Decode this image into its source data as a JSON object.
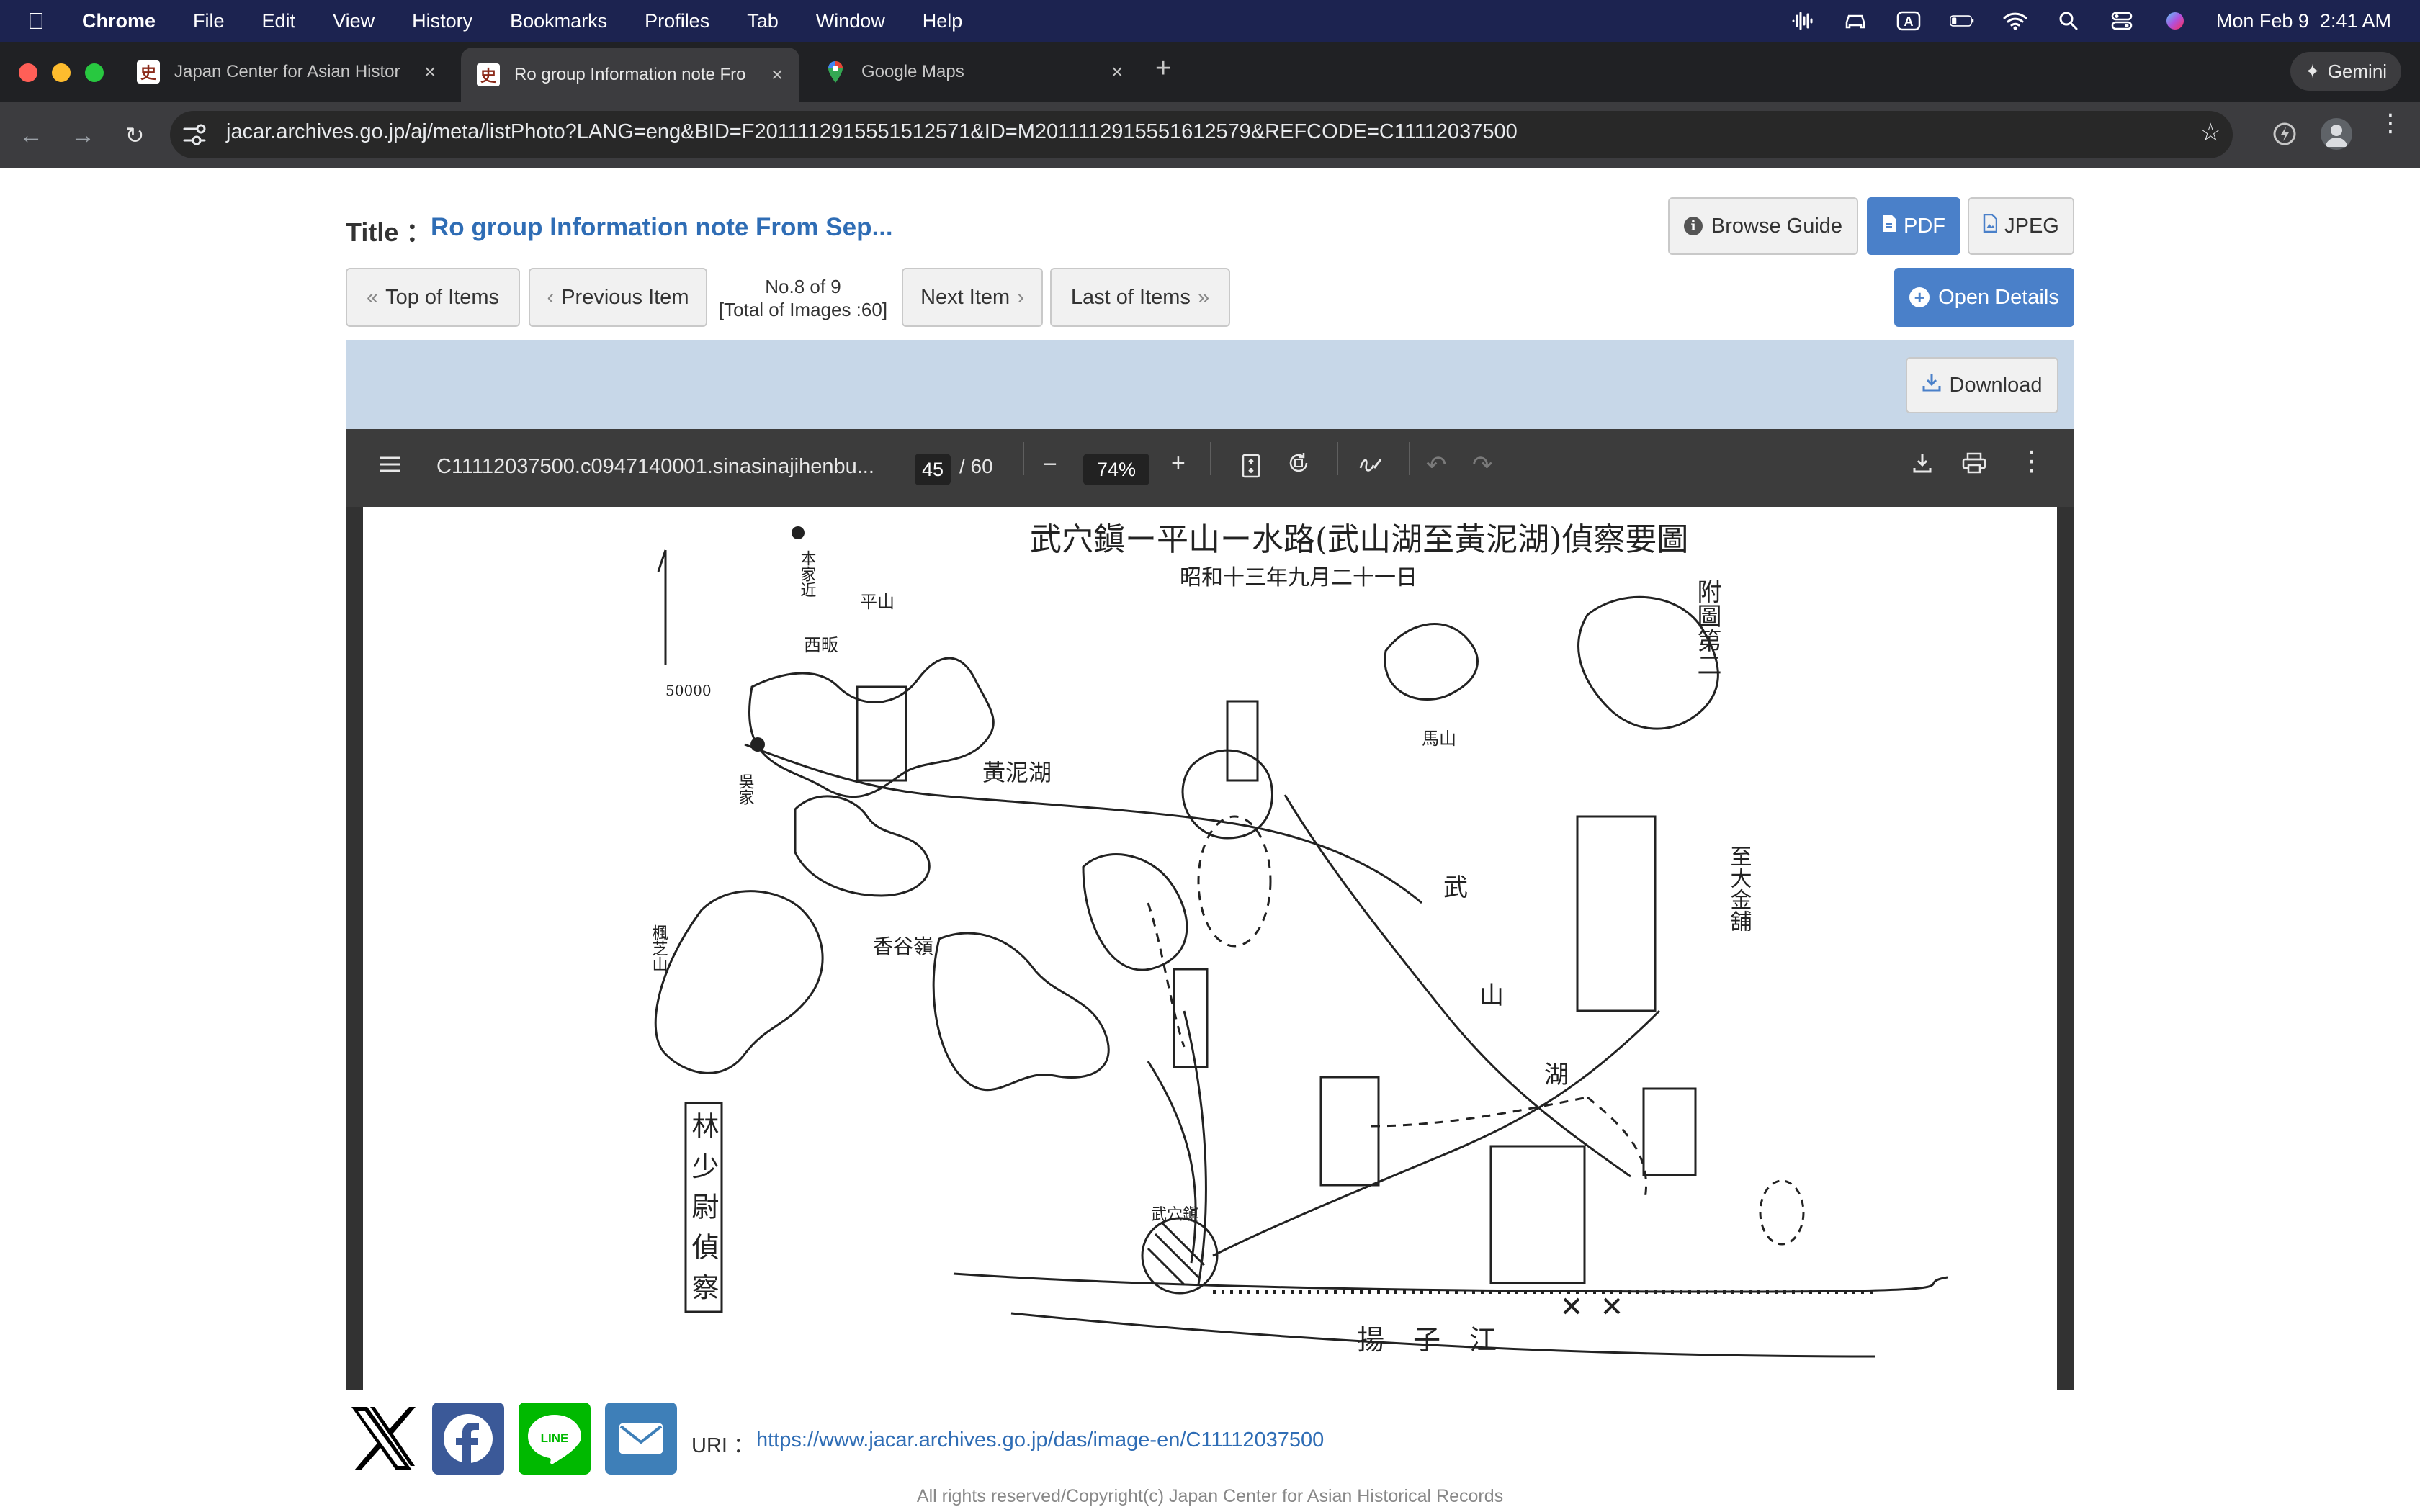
{
  "menubar": {
    "app": "Chrome",
    "items": [
      "File",
      "Edit",
      "View",
      "History",
      "Bookmarks",
      "Profiles",
      "Tab",
      "Window",
      "Help"
    ],
    "clock": "Mon Feb 9  2:41 AM"
  },
  "tabs": [
    {
      "title": "Japan Center for Asian Histor",
      "favicon": "史"
    },
    {
      "title": "Ro group Information note Fro",
      "favicon": "史"
    },
    {
      "title": "Google Maps",
      "favicon": "map-pin"
    }
  ],
  "gemini": "Gemini",
  "url": "jacar.archives.go.jp/aj/meta/listPhoto?LANG=eng&BID=F2011112915551512571&ID=M2011112915551612579&REFCODE=C11112037500",
  "page": {
    "title_label": "Title ：",
    "title_value": "Ro group Information note From Sep...",
    "browse_guide": "Browse Guide",
    "pdf": "PDF",
    "jpeg": "JPEG",
    "top_items": "Top of Items",
    "prev_item": "Previous Item",
    "counter_line1": "No.8 of 9",
    "counter_line2": "[Total of Images :60]",
    "next_item": "Next Item",
    "last_items": "Last of Items",
    "open_details": "Open Details",
    "download": "Download"
  },
  "pdf": {
    "filename": "C11112037500.c0947140001.sinasinajihenbu...",
    "page_current": "45",
    "page_total": "/ 60",
    "zoom": "74%"
  },
  "map": {
    "title": "武穴鎭ー平山ー水路(武山湖至黃泥湖)偵察要圖",
    "date": "昭和十三年九月二十一日",
    "side_label": "附圖第二",
    "signature": "林少尉偵察",
    "labels": [
      "黃泥湖",
      "武",
      "山",
      "湖",
      "揚子江",
      "至大金舖",
      "平山",
      "西畈",
      "武穴鎭",
      "吳家",
      "本家近",
      "馬山",
      "香谷嶺",
      "楓芝山"
    ],
    "scale": "50000"
  },
  "footer": {
    "uri_label": "URI ：",
    "uri": "https://www.jacar.archives.go.jp/das/image-en/C11112037500",
    "copyright": "All rights reserved/Copyright(c) Japan Center for Asian Historical Records"
  }
}
